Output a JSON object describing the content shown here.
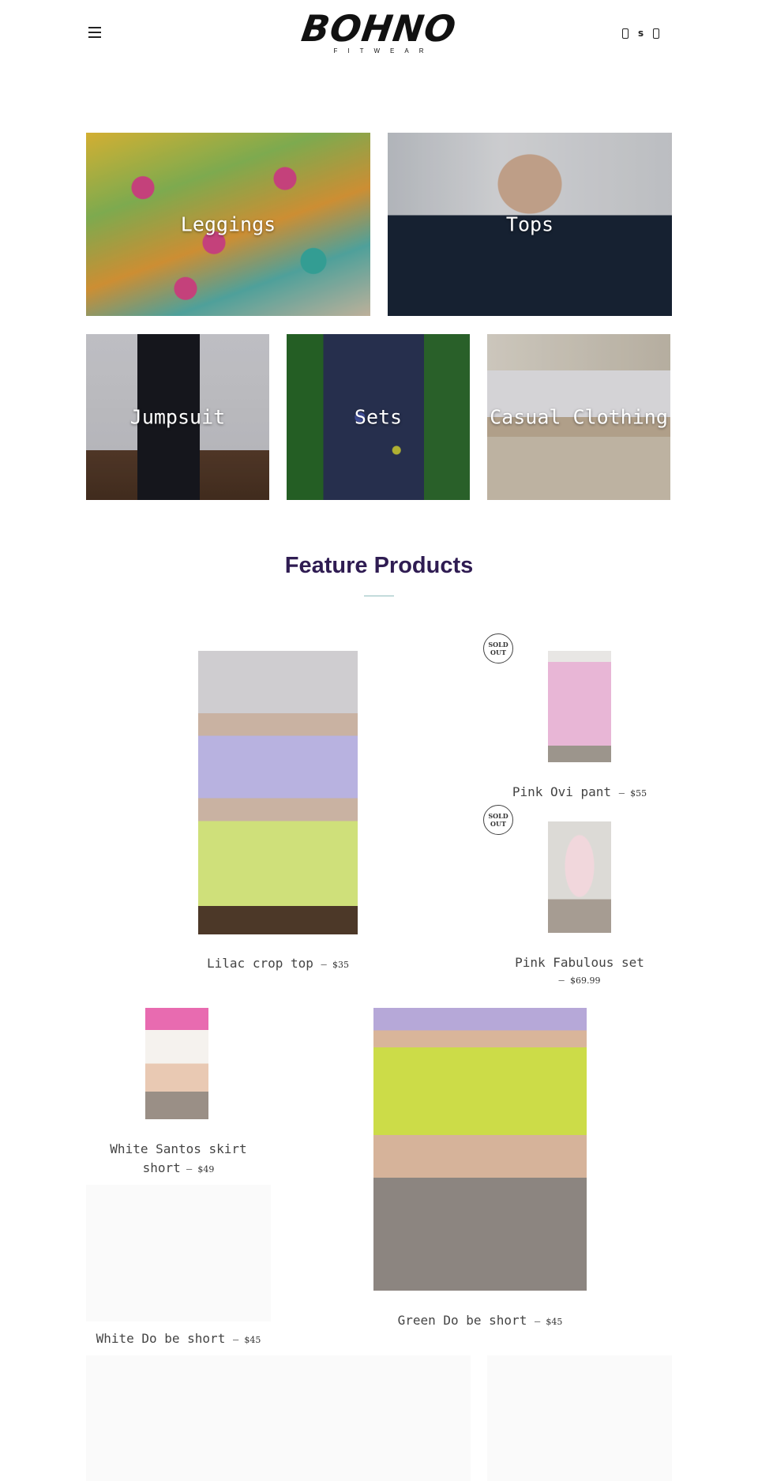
{
  "header": {
    "logo_text": "BOHNO",
    "logo_subtext": "FITWEAR",
    "icons": [
      "menu-icon",
      "account-icon",
      "search-icon",
      "cart-icon"
    ],
    "currency_label": "s"
  },
  "categories": [
    {
      "label": "Leggings"
    },
    {
      "label": "Tops"
    },
    {
      "label": "Jumpsuit"
    },
    {
      "label": "Sets"
    },
    {
      "label": "Casual Clothing"
    }
  ],
  "feature": {
    "title": "Feature Products",
    "title_color": "#2f1c52",
    "sold_out_line1": "SOLD",
    "sold_out_line2": "OUT",
    "products": [
      {
        "name": "Lilac crop top",
        "price": "$35",
        "sold_out": false
      },
      {
        "name": "Pink Ovi pant",
        "price": "$55",
        "sold_out": true
      },
      {
        "name": "Pink Fabulous set",
        "price": "$69.99",
        "sold_out": true
      },
      {
        "name_line1": "White Santos skirt",
        "name_line2": "short",
        "price": "$49",
        "sold_out": false
      },
      {
        "name": "Green Do be short",
        "price": "$45",
        "sold_out": false
      },
      {
        "name": "White Do be short",
        "price": "$45",
        "sold_out": false
      }
    ]
  }
}
